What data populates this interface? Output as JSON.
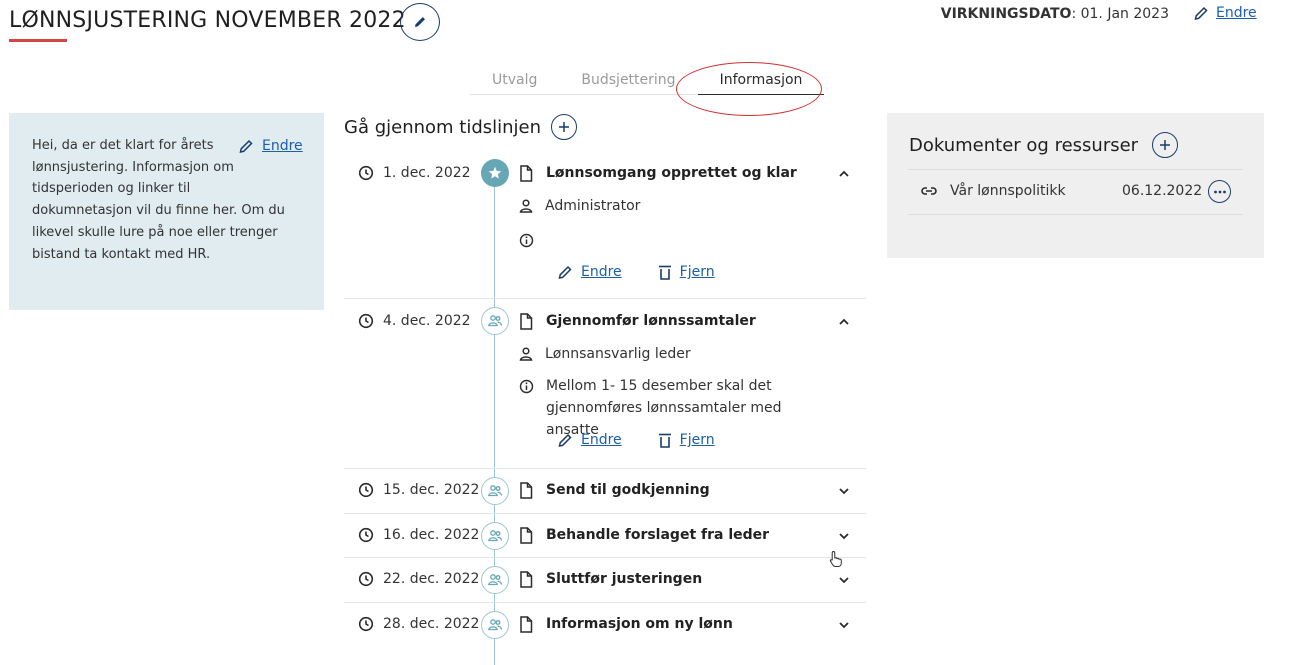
{
  "header": {
    "title": "LØNNSJUSTERING NOVEMBER 2022",
    "effective_label": "VIRKNINGSDATO",
    "effective_value": ": 01. Jan 2023",
    "edit_label": "Endre",
    "accent_color": "#d64541"
  },
  "tabs": [
    {
      "label": "Utvalg",
      "active": false
    },
    {
      "label": "Budsjettering",
      "active": false
    },
    {
      "label": "Informasjon",
      "active": true
    }
  ],
  "info_panel": {
    "text": "Hei, da er det klart for årets lønnsjustering. Informasjon om tidsperioden og linker til dokumnetasjon vil du finne her. Om du likevel skulle lure på noe eller trenger bistand ta kontakt med HR.",
    "edit_label": "Endre",
    "background": "#e0ecef"
  },
  "timeline": {
    "title": "Gå gjennom tidslinjen",
    "edit_label": "Endre",
    "remove_label": "Fjern",
    "events": [
      {
        "date": "1. dec. 2022",
        "title": "Lønnsomgang opprettet og klar",
        "responsible": "Administrator",
        "info": "",
        "expanded": true,
        "marker": "star-icon"
      },
      {
        "date": "4. dec. 2022",
        "title": "Gjennomfør lønnssamtaler",
        "responsible": "Lønnsansvarlig leder",
        "info": "Mellom 1- 15 desember skal det gjennomføres lønnssamtaler med ansatte",
        "expanded": true,
        "marker": "people-icon"
      },
      {
        "date": "15. dec. 2022",
        "title": "Send til godkjenning",
        "expanded": false,
        "marker": "people-icon"
      },
      {
        "date": "16. dec. 2022",
        "title": "Behandle forslaget fra leder",
        "expanded": false,
        "marker": "people-icon"
      },
      {
        "date": "22. dec. 2022",
        "title": "Sluttfør justeringen",
        "expanded": false,
        "marker": "people-icon"
      },
      {
        "date": "28. dec. 2022",
        "title": "Informasjon om ny lønn",
        "expanded": false,
        "marker": "people-icon"
      }
    ]
  },
  "documents": {
    "title": "Dokumenter og ressurser",
    "items": [
      {
        "name": "Vår lønnspolitikk",
        "date": "06.12.2022"
      }
    ]
  }
}
